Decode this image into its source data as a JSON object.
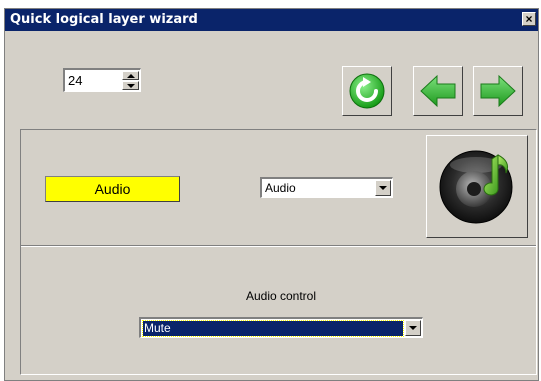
{
  "window": {
    "title": "Quick logical layer wizard",
    "close_label": "×"
  },
  "spinner": {
    "value": "24"
  },
  "toolbar": {
    "buttons": [
      {
        "name": "refresh-button",
        "icon": "refresh-icon",
        "color": "#2fb52f"
      },
      {
        "name": "back-button",
        "icon": "arrow-left-icon",
        "color": "#2fb52f"
      },
      {
        "name": "forward-button",
        "icon": "arrow-right-icon",
        "color": "#2fb52f"
      }
    ]
  },
  "layer": {
    "name_label": "Audio",
    "name_bg": "#ffff00",
    "type_select": {
      "selected": "Audio"
    },
    "icon": "music-speaker-icon"
  },
  "audio_control": {
    "label": "Audio control",
    "select": {
      "selected": "Mute"
    }
  }
}
